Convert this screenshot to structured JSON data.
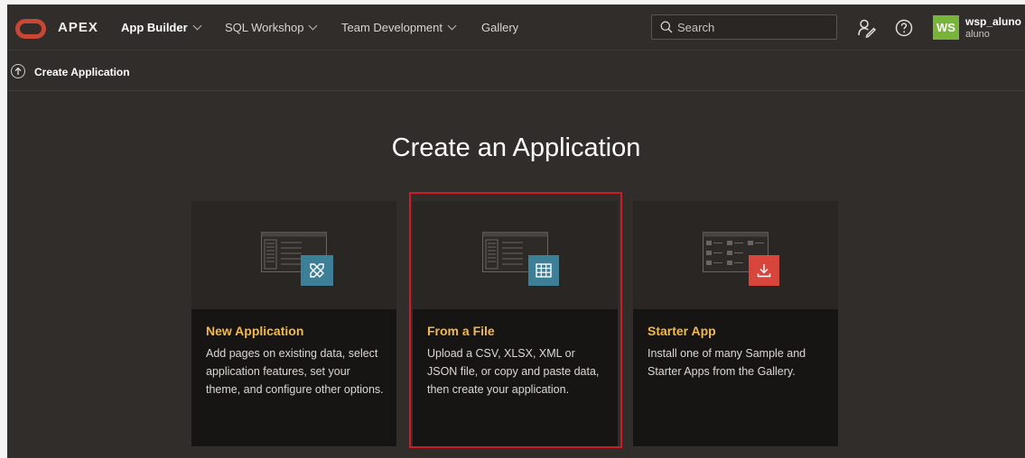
{
  "header": {
    "brand": "APEX",
    "nav": [
      {
        "label": "App Builder",
        "active": true
      },
      {
        "label": "SQL Workshop",
        "active": false
      },
      {
        "label": "Team Development",
        "active": false
      },
      {
        "label": "Gallery",
        "active": false
      }
    ],
    "search": {
      "placeholder": "Search"
    },
    "icons": [
      "user-edit-icon",
      "help-icon"
    ],
    "user": {
      "initials": "WS",
      "name": "wsp_aluno",
      "sub": "aluno"
    }
  },
  "breadcrumb": {
    "label": "Create Application"
  },
  "main": {
    "title": "Create an Application",
    "cards": [
      {
        "title": "New Application",
        "description": "Add pages on existing data, select application features, set your theme, and configure other options.",
        "icon": "tools-icon",
        "badge_color": "#3d7f97"
      },
      {
        "title": "From a File",
        "description": "Upload a CSV, XLSX, XML or JSON file, or copy and paste data, then create your application.",
        "icon": "table-icon",
        "badge_color": "#3d7f97",
        "selected": true
      },
      {
        "title": "Starter App",
        "description": "Install one of many Sample and Starter Apps from the Gallery.",
        "icon": "download-icon",
        "badge_color": "#d8453a"
      }
    ]
  },
  "colors": {
    "accent": "#f3b94a",
    "selection": "#d01a24",
    "avatar": "#78b43a",
    "logo": "#c74634"
  }
}
